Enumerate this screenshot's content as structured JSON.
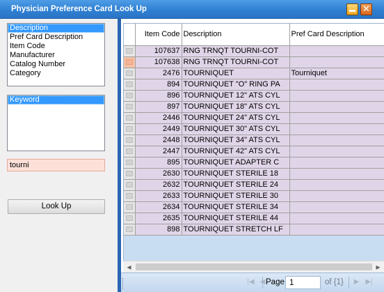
{
  "window": {
    "title": "Physician Preference Card Look Up"
  },
  "search_fields": [
    "Description",
    "Pref Card Description",
    "Item Code",
    "Manufacturer",
    "Catalog Number",
    "Category"
  ],
  "search_types": [
    "Keyword"
  ],
  "search": {
    "value": "tourni"
  },
  "lookup_button": {
    "label": "Look Up"
  },
  "grid": {
    "columns": [
      "Item Code",
      "Description",
      "Pref Card Description"
    ],
    "rows": [
      [
        "107637",
        "RNG TRNQT TOURNI-COT",
        ""
      ],
      [
        "107638",
        "RNG TRNQT TOURNI-COT",
        ""
      ],
      [
        "2476",
        "TOURNIQUET",
        "Tourniquet"
      ],
      [
        "894",
        "TOURNIQUET \"O\" RING PA",
        ""
      ],
      [
        "896",
        "TOURNIQUET 12\" ATS CYL",
        ""
      ],
      [
        "897",
        "TOURNIQUET 18\" ATS CYL",
        ""
      ],
      [
        "2446",
        "TOURNIQUET 24\" ATS CYL",
        ""
      ],
      [
        "2449",
        "TOURNIQUET 30\" ATS CYL",
        ""
      ],
      [
        "2448",
        "TOURNIQUET 34\" ATS CYL",
        ""
      ],
      [
        "2447",
        "TOURNIQUET 42\" ATS CYL",
        ""
      ],
      [
        "895",
        "TOURNIQUET ADAPTER C",
        ""
      ],
      [
        "2630",
        "TOURNIQUET STERILE 18",
        ""
      ],
      [
        "2632",
        "TOURNIQUET STERILE 24",
        ""
      ],
      [
        "2633",
        "TOURNIQUET STERILE 30",
        ""
      ],
      [
        "2634",
        "TOURNIQUET STERILE 34",
        ""
      ],
      [
        "2635",
        "TOURNIQUET STERILE 44",
        ""
      ],
      [
        "898",
        "TOURNIQUET STRETCH LF",
        ""
      ]
    ]
  },
  "pager": {
    "page_label": "Page",
    "page_value": "1",
    "of_text": "of {1}"
  },
  "icons": {
    "minimize": "minimize-icon",
    "close": "close-icon",
    "scroll_left": "arrow-left-icon",
    "scroll_right": "arrow-right-icon",
    "first_page": "first-page-icon",
    "prev_page": "prev-page-icon",
    "next_page": "next-page-icon",
    "last_page": "last-page-icon"
  },
  "colors": {
    "titlebar": "#2f80d3",
    "row_bg": "#e0d5e8",
    "selected": "#3399ff",
    "search_bg": "#fde1d8",
    "pager_bg": "#c3d7ee"
  }
}
